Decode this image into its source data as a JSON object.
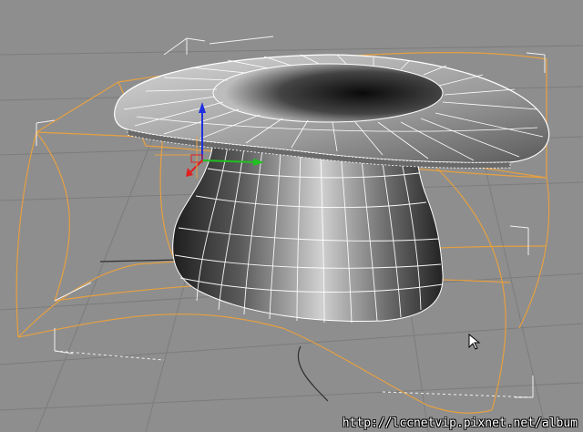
{
  "viewport": {
    "name": "3D perspective viewport",
    "background": "#8e8e8e",
    "grid_color": "#7c7c7c",
    "grid_axis_color": "#2e2e2e"
  },
  "object": {
    "name": "top hat mesh",
    "shade_light": "#bdbdbd",
    "shade_dark": "#1a1a1a",
    "wire_color": "#ffffff"
  },
  "modifier_lattice": {
    "name": "FFD lattice",
    "color": "#e6a040"
  },
  "bounding_box": {
    "color": "#f0f0f0"
  },
  "gizmo": {
    "axes": [
      "x-axis",
      "y-axis",
      "z-axis"
    ],
    "x_color": "#e02020",
    "y_color": "#20c020",
    "z_color": "#2030e0"
  },
  "watermark": {
    "text": "http://lccnetvip.pixnet.net/album"
  },
  "cursor": {
    "icon": "arrow-cursor-icon"
  }
}
